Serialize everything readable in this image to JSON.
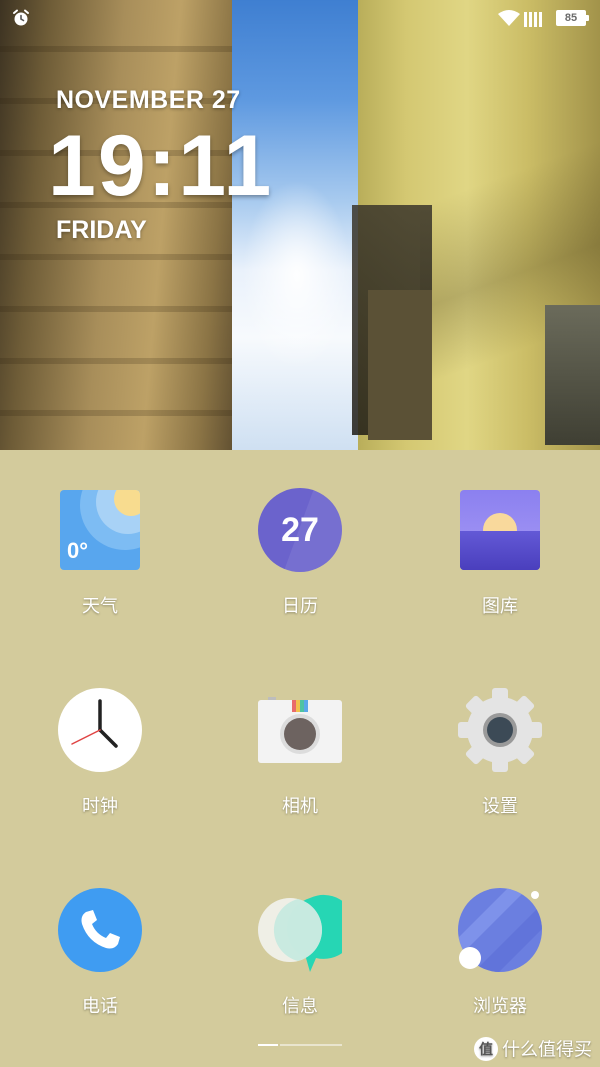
{
  "status_bar": {
    "alarm_icon": "alarm-clock-icon",
    "wifi_icon": "wifi-icon",
    "signal_icon": "signal-bars-icon",
    "battery_level": "85"
  },
  "clock_widget": {
    "date": "NOVEMBER 27",
    "time": "19:11",
    "day": "FRIDAY"
  },
  "apps": [
    {
      "label": "天气",
      "icon": "weather-icon",
      "badge": "0°"
    },
    {
      "label": "日历",
      "icon": "calendar-icon",
      "badge": "27"
    },
    {
      "label": "图库",
      "icon": "gallery-icon"
    },
    {
      "label": "时钟",
      "icon": "clock-icon"
    },
    {
      "label": "相机",
      "icon": "camera-icon"
    },
    {
      "label": "设置",
      "icon": "settings-icon"
    },
    {
      "label": "电话",
      "icon": "phone-icon"
    },
    {
      "label": "信息",
      "icon": "messages-icon"
    },
    {
      "label": "浏览器",
      "icon": "browser-icon"
    }
  ],
  "page_indicator": {
    "pages": 2,
    "current": 1
  },
  "watermark": {
    "logo_text": "值",
    "text": "什么值得买"
  },
  "colors": {
    "dock_background": "#d3cb9c",
    "calendar": "#6b63cc",
    "weather": "#58a6ee",
    "phone": "#3f9cf2",
    "messages_accent": "#26d6b4",
    "browser": "#6b7fe0"
  }
}
